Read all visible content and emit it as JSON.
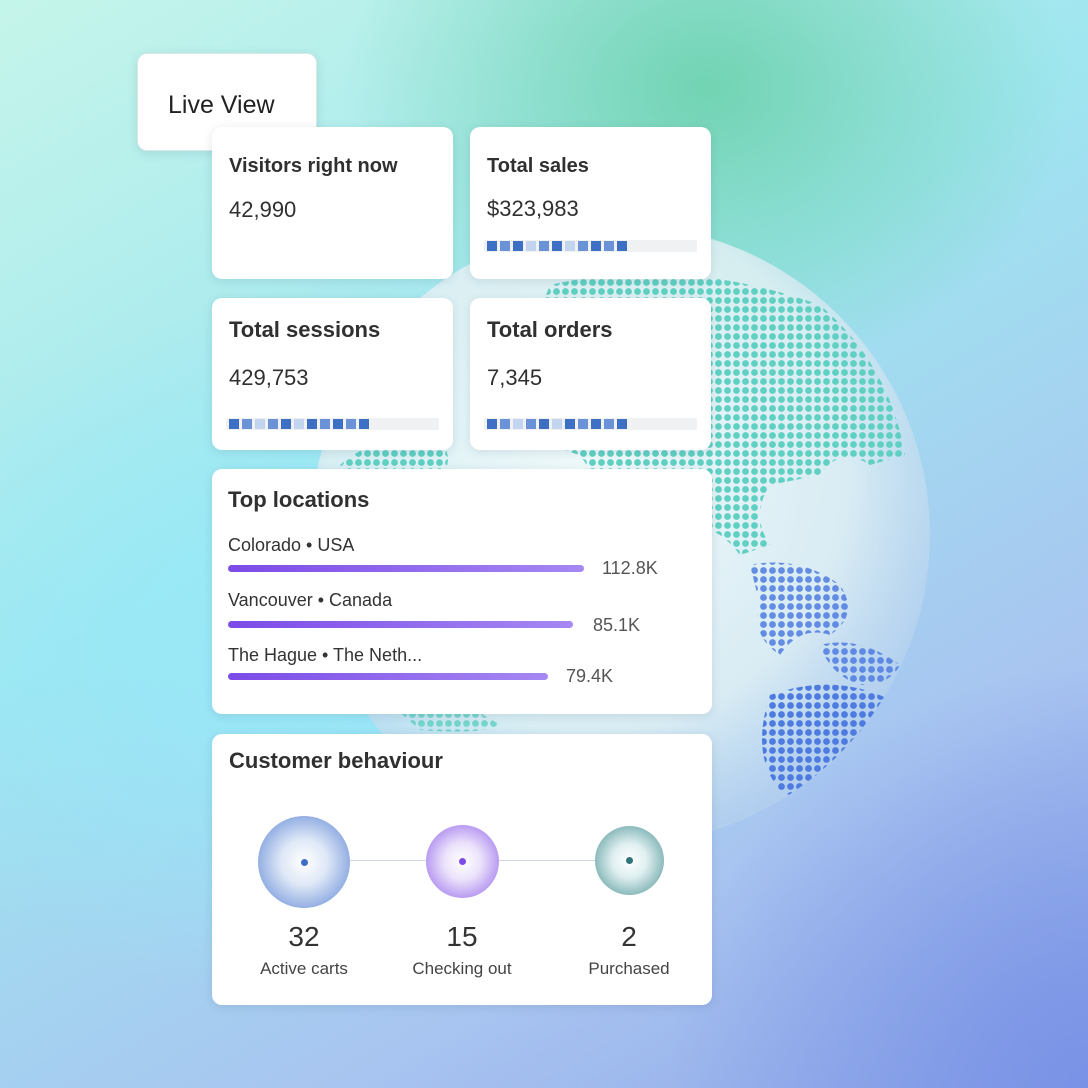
{
  "live_view": {
    "label": "Live View"
  },
  "metrics": {
    "visitors": {
      "title": "Visitors right now",
      "value": "42,990"
    },
    "sales": {
      "title": "Total sales",
      "value": "$323,983"
    },
    "sessions": {
      "title": "Total sessions",
      "value": "429,753"
    },
    "orders": {
      "title": "Total orders",
      "value": "7,345"
    }
  },
  "top_locations": {
    "title": "Top locations",
    "items": [
      {
        "name": "Colorado • USA",
        "value": "112.8K"
      },
      {
        "name": "Vancouver • Canada",
        "value": "85.1K"
      },
      {
        "name": "The Hague • The Neth...",
        "value": "79.4K"
      }
    ]
  },
  "customer_behaviour": {
    "title": "Customer behaviour",
    "stages": [
      {
        "count": "32",
        "label": "Active carts"
      },
      {
        "count": "15",
        "label": "Checking out"
      },
      {
        "count": "2",
        "label": "Purchased"
      }
    ]
  },
  "colors": {
    "accent_purple": "#7c4be8",
    "spark_blue_dark": "#3d6fc4",
    "spark_blue_light": "#a9c2ea",
    "globe_teal": "#5fd4c4",
    "globe_blue": "#4d78e0"
  }
}
